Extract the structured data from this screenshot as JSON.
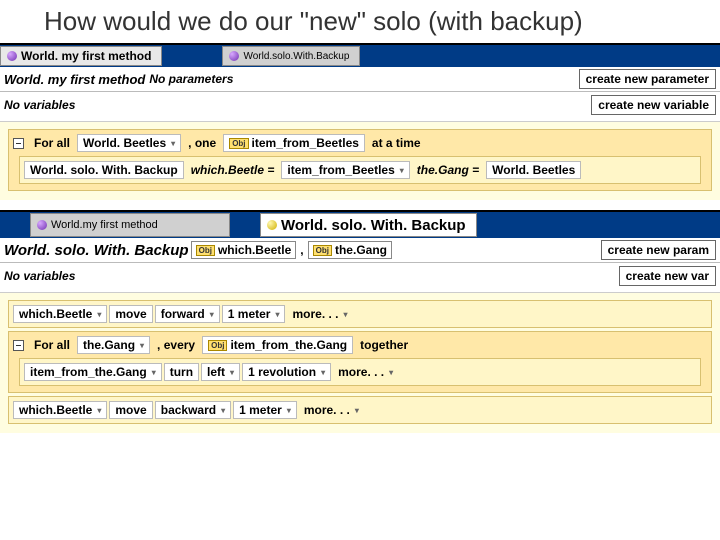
{
  "slide": {
    "title": "How would we do our \"new\" solo (with backup)"
  },
  "panel1": {
    "tabs": {
      "active": "World. my first method",
      "inactive": "World.solo.With.Backup"
    },
    "signature": {
      "name": "World. my first method",
      "noparams": "No parameters"
    },
    "buttons": {
      "newparam": "create new parameter",
      "newvar": "create new variable"
    },
    "novars": "No variables",
    "forall": {
      "kw1": "For all",
      "coll": "World. Beetles",
      "comma": ", one",
      "itemlabel": "item_from_Beetles",
      "tail": "at a time"
    },
    "call": {
      "method": "World. solo. With. Backup",
      "p1name": "which.Beetle =",
      "p1val": "item_from_Beetles",
      "p2name": "the.Gang =",
      "p2val": "World. Beetles"
    }
  },
  "panel2": {
    "tabs": {
      "inactive": "World.my first method",
      "active": "World. solo. With. Backup"
    },
    "signature": {
      "name": "World. solo. With. Backup",
      "p1": "which.Beetle",
      "comma": ",",
      "p2": "the.Gang"
    },
    "buttons": {
      "newparam": "create new param",
      "newvar": "create new var"
    },
    "novars": "No variables",
    "row1": {
      "subj": "which.Beetle",
      "verb": "move",
      "dir": "forward",
      "amt": "1 meter",
      "more": "more. . ."
    },
    "forall": {
      "kw1": "For all",
      "coll": "the.Gang",
      "comma": ", every",
      "item": "item_from_the.Gang",
      "tail": "together"
    },
    "row2": {
      "subj": "item_from_the.Gang",
      "verb": "turn",
      "dir": "left",
      "amt": "1 revolution",
      "more": "more. . ."
    },
    "row3": {
      "subj": "which.Beetle",
      "verb": "move",
      "dir": "backward",
      "amt": "1 meter",
      "more": "more. . ."
    }
  }
}
